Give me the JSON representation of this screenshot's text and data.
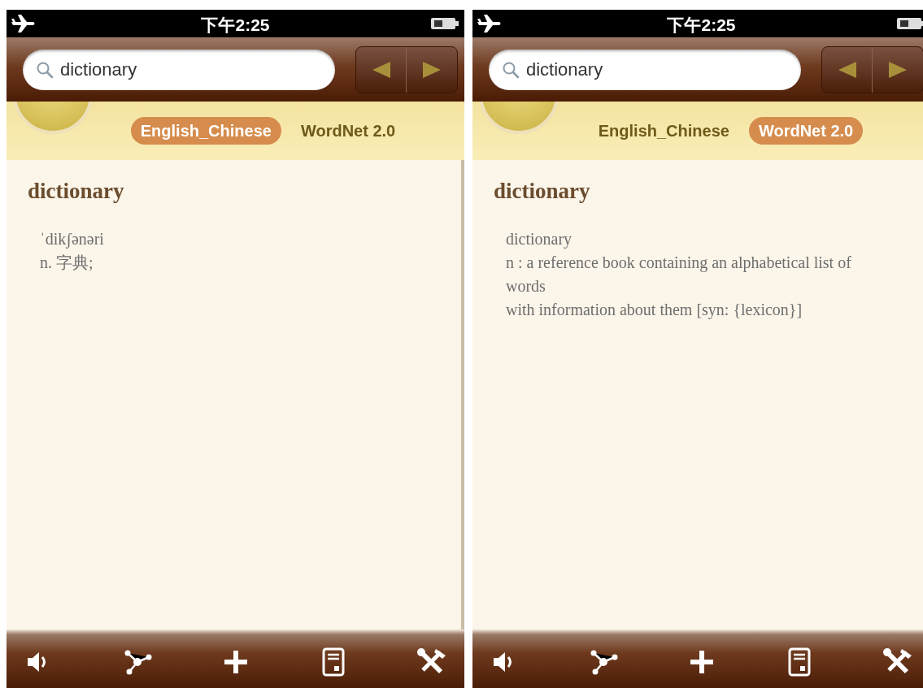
{
  "screens": [
    {
      "status_bar": {
        "time": "下午2:25"
      },
      "search": {
        "value": "dictionary"
      },
      "dictionaries": [
        {
          "label": "English_Chinese",
          "selected": true
        },
        {
          "label": "WordNet 2.0",
          "selected": false
        }
      ],
      "entry": {
        "headword": "dictionary",
        "lines": [
          "ˈdikʃənəri",
          "n. 字典;"
        ]
      }
    },
    {
      "status_bar": {
        "time": "下午2:25"
      },
      "search": {
        "value": "dictionary"
      },
      "dictionaries": [
        {
          "label": "English_Chinese",
          "selected": false
        },
        {
          "label": "WordNet 2.0",
          "selected": true
        }
      ],
      "entry": {
        "headword": "dictionary",
        "lines": [
          "dictionary",
          "n : a reference book containing an alphabetical list of words",
          "with information about them [syn: {lexicon}]"
        ]
      }
    }
  ]
}
